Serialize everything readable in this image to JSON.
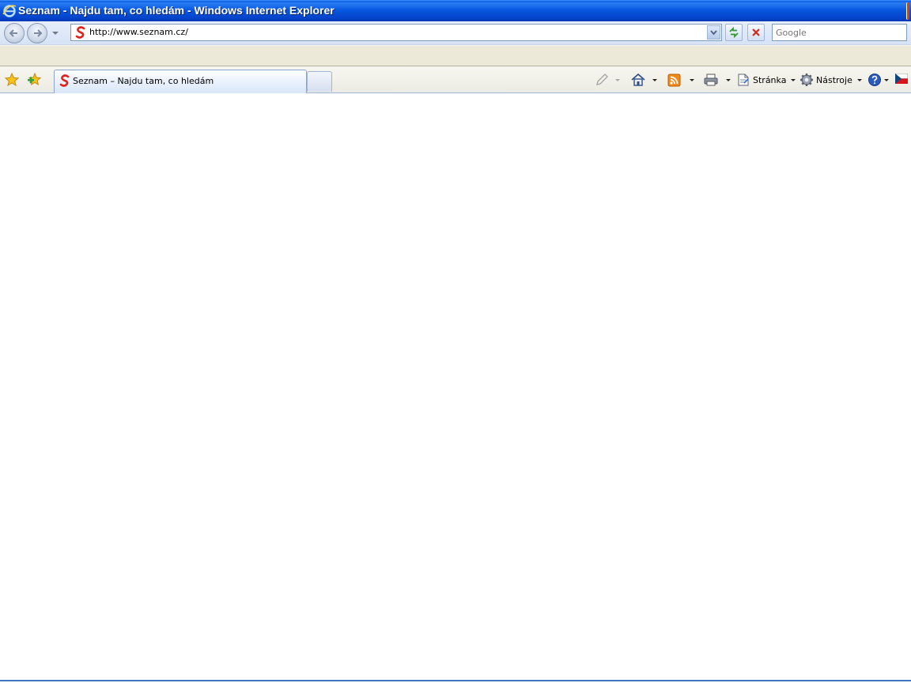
{
  "window": {
    "title": "Seznam - Najdu tam, co hledám - Windows Internet Explorer"
  },
  "navigation": {
    "address": "http://www.seznam.cz/",
    "search_placeholder": "Google"
  },
  "tabs": [
    {
      "label": "Seznam – Najdu tam, co hledám",
      "active": true
    }
  ],
  "command_bar": {
    "page_label": "Stránka",
    "tools_label": "Nástroje"
  },
  "colors": {
    "titlebar": "#0858df",
    "favicon_red": "#e2201b",
    "feed_orange": "#f08a1b"
  }
}
